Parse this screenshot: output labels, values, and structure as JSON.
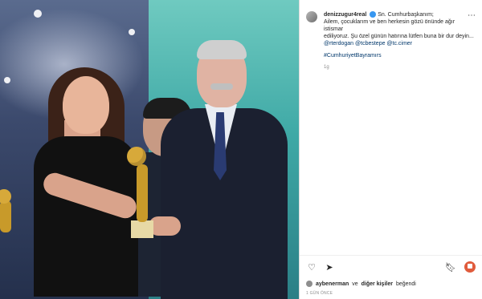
{
  "post": {
    "username": "denizzugur4real",
    "caption_line1": "Sn. Cumhurbaşkanım;",
    "caption_line2": "Ailem, çocuklarım ve ben herkesin gözü önünde ağır istismar",
    "caption_line3": "ediliyoruz. Şu özel günün hatırına lütfen buna bir dur deyin...",
    "mentions": "@rterdogan @tcbestepe @tc.cimer",
    "hashtag": "#CumhuriyetBayramırs",
    "time": "1g",
    "likes_by": "aybenerman",
    "likes_and": "ve",
    "likes_others": "diğer kişiler",
    "likes_suffix": "beğendi",
    "date": "1 GÜN ÖNCE"
  },
  "icons": {
    "more": "more-icon",
    "like": "heart-icon",
    "share": "send-icon",
    "save": "bookmark-icon",
    "stop": "stop-icon"
  },
  "colors": {
    "link": "#00376b",
    "verified": "#3897f0",
    "stop": "#e05b3c"
  }
}
